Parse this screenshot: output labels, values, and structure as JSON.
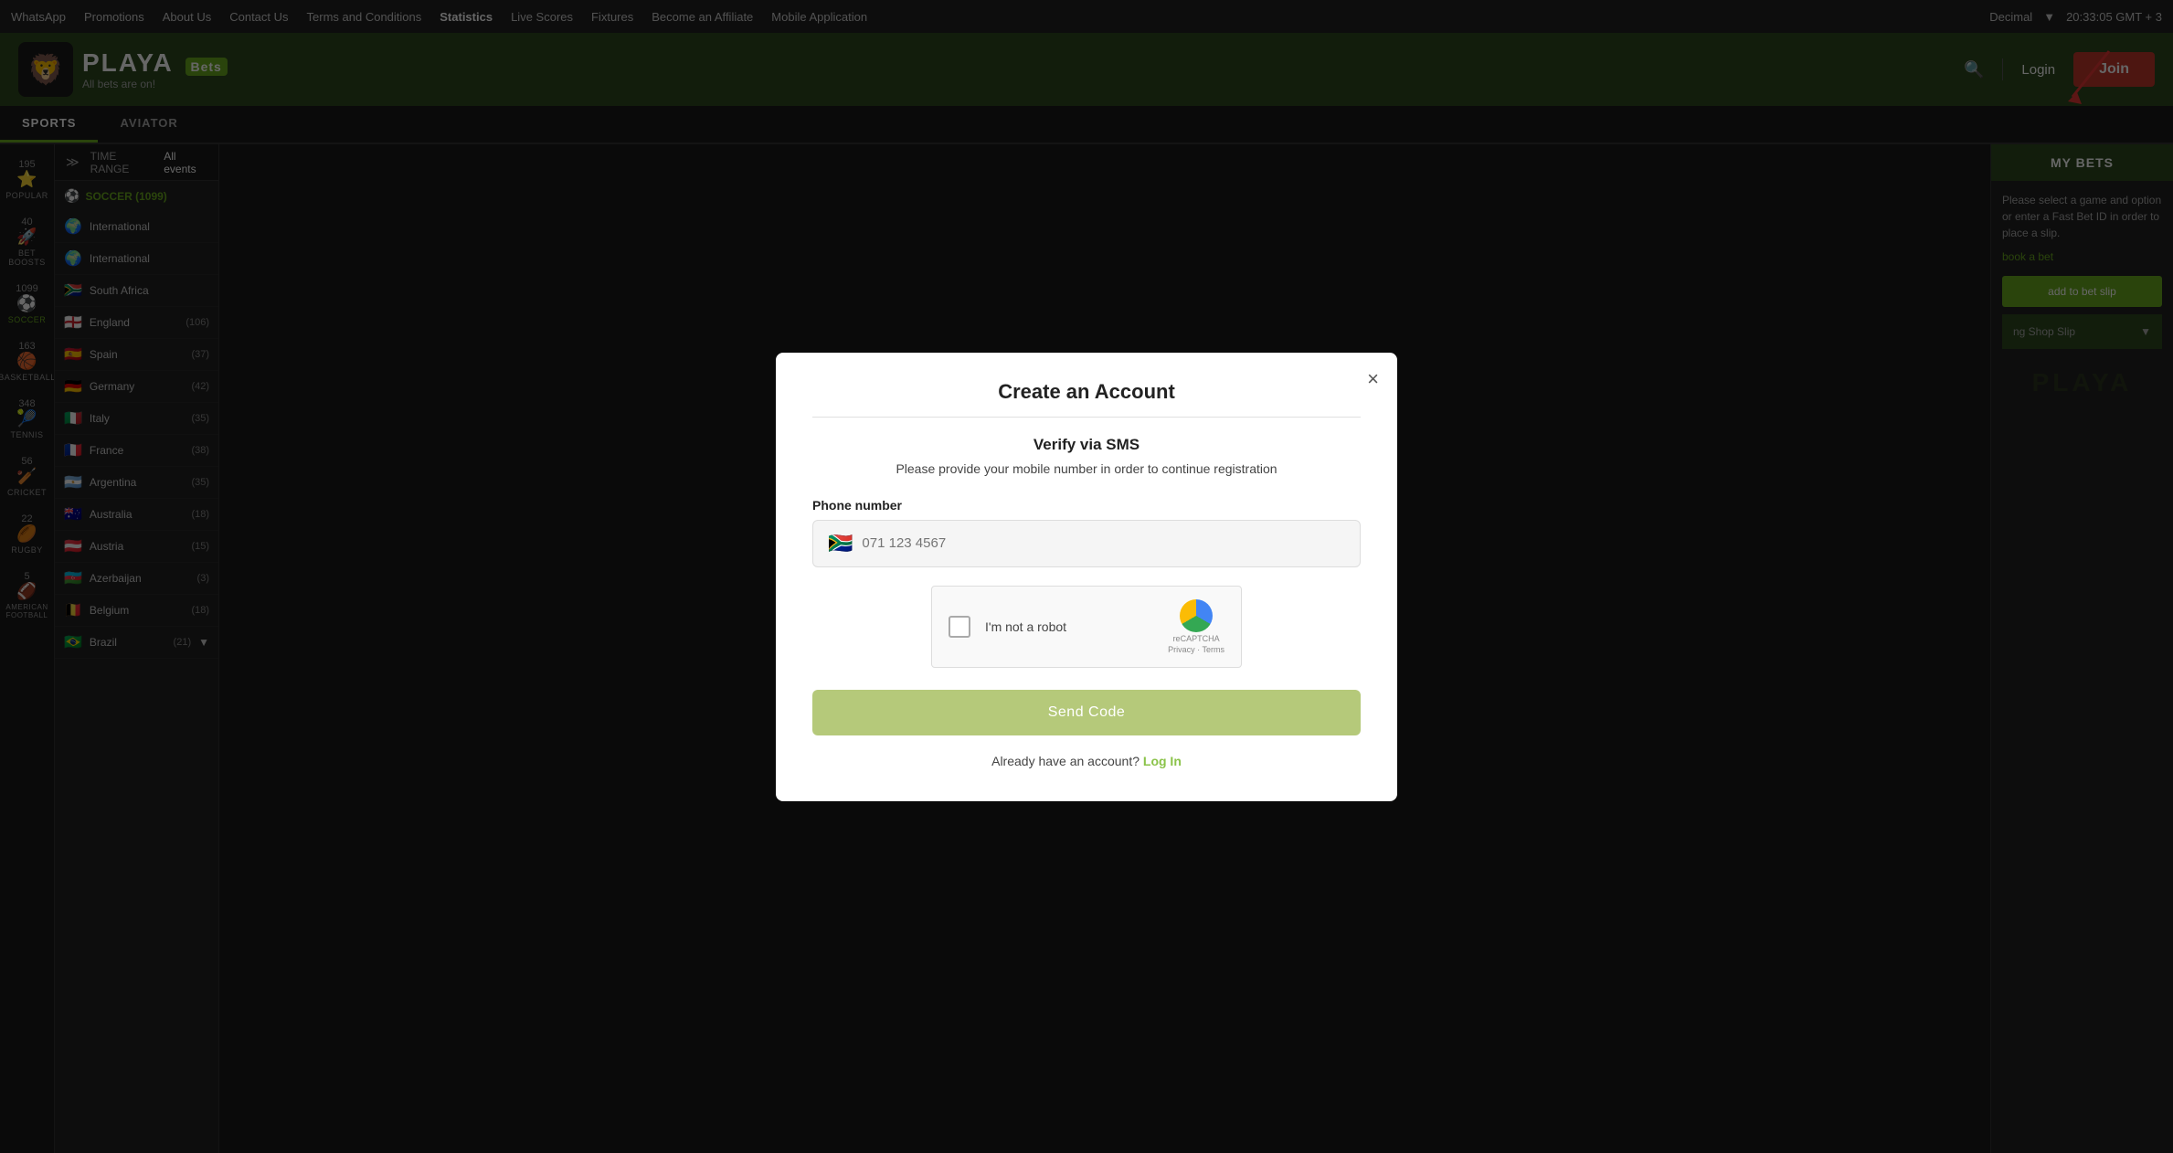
{
  "topnav": {
    "items": [
      {
        "label": "WhatsApp",
        "key": "whatsapp"
      },
      {
        "label": "Promotions",
        "key": "promotions"
      },
      {
        "label": "About Us",
        "key": "about"
      },
      {
        "label": "Contact Us",
        "key": "contact"
      },
      {
        "label": "Terms and Conditions",
        "key": "terms"
      },
      {
        "label": "Statistics",
        "key": "stats"
      },
      {
        "label": "Live Scores",
        "key": "live-scores"
      },
      {
        "label": "Fixtures",
        "key": "fixtures"
      },
      {
        "label": "Become an Affiliate",
        "key": "affiliate"
      },
      {
        "label": "Mobile Application",
        "key": "mobile"
      }
    ],
    "right": {
      "decimal": "Decimal",
      "time": "20:33:05 GMT + 3"
    }
  },
  "header": {
    "logo_text": "PLAYA",
    "bets_badge": "Bets",
    "tagline": "All bets are on!",
    "search_label": "search",
    "login_label": "Login",
    "join_label": "Join"
  },
  "sports_tabs": [
    {
      "label": "SPORTS",
      "active": true
    },
    {
      "label": "AVIATOR",
      "active": false
    }
  ],
  "time_range": {
    "label": "TIME RANGE",
    "filter": "All events"
  },
  "icon_sidebar": [
    {
      "count": "195",
      "icon": "⭐",
      "label": "POPULAR"
    },
    {
      "count": "40",
      "icon": "🚀",
      "label": "BET BOOSTS"
    },
    {
      "count": "1099",
      "icon": "⚽",
      "label": "SOCCER",
      "active": true
    },
    {
      "count": "163",
      "icon": "🏀",
      "label": "BASKETBALL"
    },
    {
      "count": "348",
      "icon": "🎾",
      "label": "TENNIS"
    },
    {
      "count": "56",
      "icon": "🏏",
      "label": "CRICKET"
    },
    {
      "count": "22",
      "icon": "🏉",
      "label": "RUGBY"
    },
    {
      "count": "5",
      "icon": "🏈",
      "label": "AMERICAN FOOTBALL"
    }
  ],
  "sports_list": {
    "section_header": "SOCCER (1099)",
    "items": [
      {
        "flag": "🌍",
        "name": "International",
        "count": ""
      },
      {
        "flag": "🌍",
        "name": "International",
        "count": ""
      },
      {
        "flag": "🇿🇦",
        "name": "South Africa",
        "count": ""
      },
      {
        "flag": "🏴",
        "name": "England",
        "count": "(106)"
      },
      {
        "flag": "🇪🇸",
        "name": "Spain",
        "count": "(37)"
      },
      {
        "flag": "🇩🇪",
        "name": "Germany",
        "count": "(42)"
      },
      {
        "flag": "🇮🇹",
        "name": "Italy",
        "count": "(35)"
      },
      {
        "flag": "🇫🇷",
        "name": "France",
        "count": "(38)"
      },
      {
        "flag": "🇦🇷",
        "name": "Argentina",
        "count": "(35)"
      },
      {
        "flag": "🇦🇺",
        "name": "Australia",
        "count": "(18)"
      },
      {
        "flag": "🇦🇹",
        "name": "Austria",
        "count": "(15)"
      },
      {
        "flag": "🇦🇿",
        "name": "Azerbaijan",
        "count": "(3)"
      },
      {
        "flag": "🇧🇪",
        "name": "Belgium",
        "count": "(18)"
      },
      {
        "flag": "🇧🇷",
        "name": "Brazil",
        "count": "(21)"
      }
    ]
  },
  "right_sidebar": {
    "my_bets_label": "MY BETS",
    "description": "Please select a game and option or enter a Fast Bet ID in order to place a slip.",
    "book_bet_label": "book a bet",
    "add_to_slip_label": "add to bet slip",
    "shop_slip_label": "ng Shop Slip",
    "watermark": "PLAYA"
  },
  "modal": {
    "title": "Create an Account",
    "close_label": "×",
    "subtitle": "Verify via SMS",
    "description": "Please provide your mobile number in order to continue registration",
    "phone_label": "Phone number",
    "phone_placeholder": "071 123 4567",
    "phone_flag": "🇿🇦",
    "recaptcha_label": "I'm not a robot",
    "recaptcha_badge": "reCAPTCHA",
    "recaptcha_privacy": "Privacy",
    "recaptcha_terms": "Terms",
    "send_code_label": "Send Code",
    "already_account": "Already have an account?",
    "login_link_label": "Log In"
  }
}
